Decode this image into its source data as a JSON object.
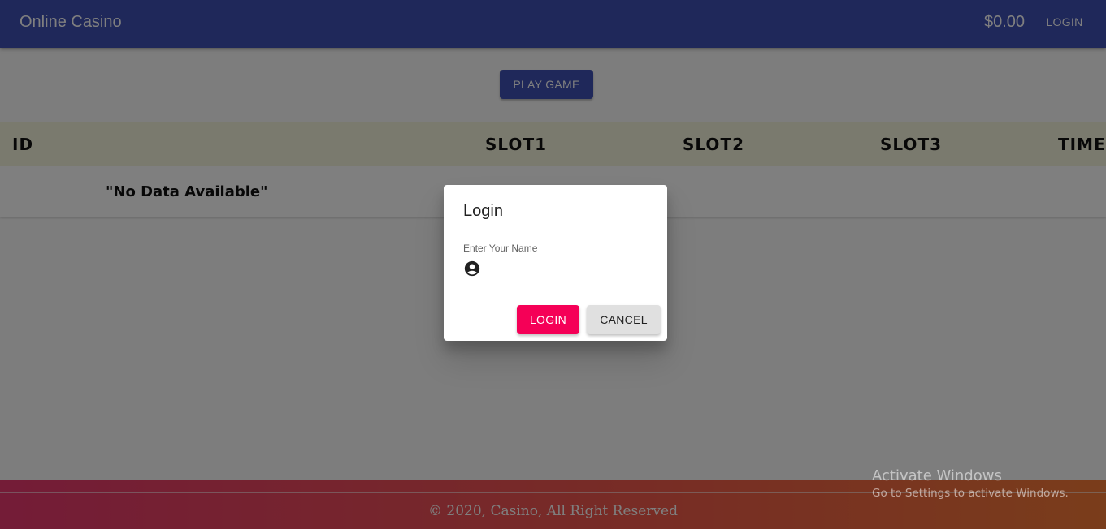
{
  "appbar": {
    "title": "Online Casino",
    "balance": "$0.00",
    "login_label": "LOGIN"
  },
  "main": {
    "play_button": "PLAY GAME",
    "table": {
      "columns": [
        "ID",
        "SLOT1",
        "SLOT2",
        "SLOT3",
        "TIME"
      ],
      "empty_message": "\"No Data Available\""
    }
  },
  "footer": {
    "text": "© 2020, Casino, All Right Reserved"
  },
  "dialog": {
    "title": "Login",
    "field_label": "Enter Your Name",
    "field_value": "",
    "field_icon": "account-circle-icon",
    "login_button": "LOGIN",
    "cancel_button": "CANCEL"
  },
  "watermark": {
    "title": "Activate Windows",
    "subtitle": "Go to Settings to activate Windows."
  },
  "colors": {
    "appbar": "#3f51b5",
    "primary_button": "#3f51b5",
    "login_button": "#f50057",
    "cancel_button": "#e0e0e0",
    "table_header": "#f5f5dc",
    "footer_gradient_start": "#e8386f",
    "footer_gradient_end": "#f47a36"
  }
}
